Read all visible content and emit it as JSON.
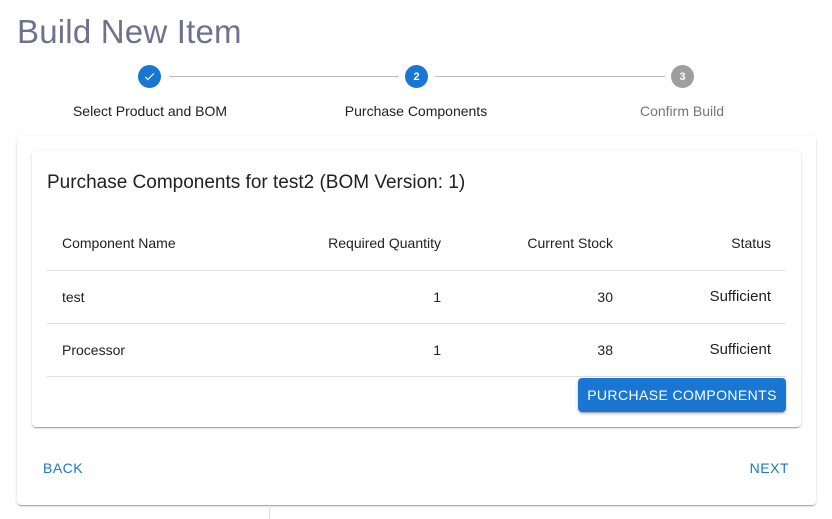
{
  "page": {
    "title": "Build New Item"
  },
  "stepper": {
    "steps": [
      {
        "number": "1",
        "label": "Select Product and BOM",
        "state": "completed"
      },
      {
        "number": "2",
        "label": "Purchase Components",
        "state": "active"
      },
      {
        "number": "3",
        "label": "Confirm Build",
        "state": "pending"
      }
    ]
  },
  "card": {
    "title": "Purchase Components for test2 (BOM Version: 1)",
    "table": {
      "headers": [
        "Component Name",
        "Required Quantity",
        "Current Stock",
        "Status"
      ],
      "rows": [
        {
          "name": "test",
          "required": "1",
          "stock": "30",
          "status": "Sufficient"
        },
        {
          "name": "Processor",
          "required": "1",
          "stock": "38",
          "status": "Sufficient"
        }
      ]
    },
    "purchase_label": "Purchase Components"
  },
  "nav": {
    "back_label": "Back",
    "next_label": "Next"
  },
  "colors": {
    "primary": "#1976d2",
    "success": "#2e7d32",
    "title": "#72708f",
    "pending": "#9e9e9e"
  }
}
